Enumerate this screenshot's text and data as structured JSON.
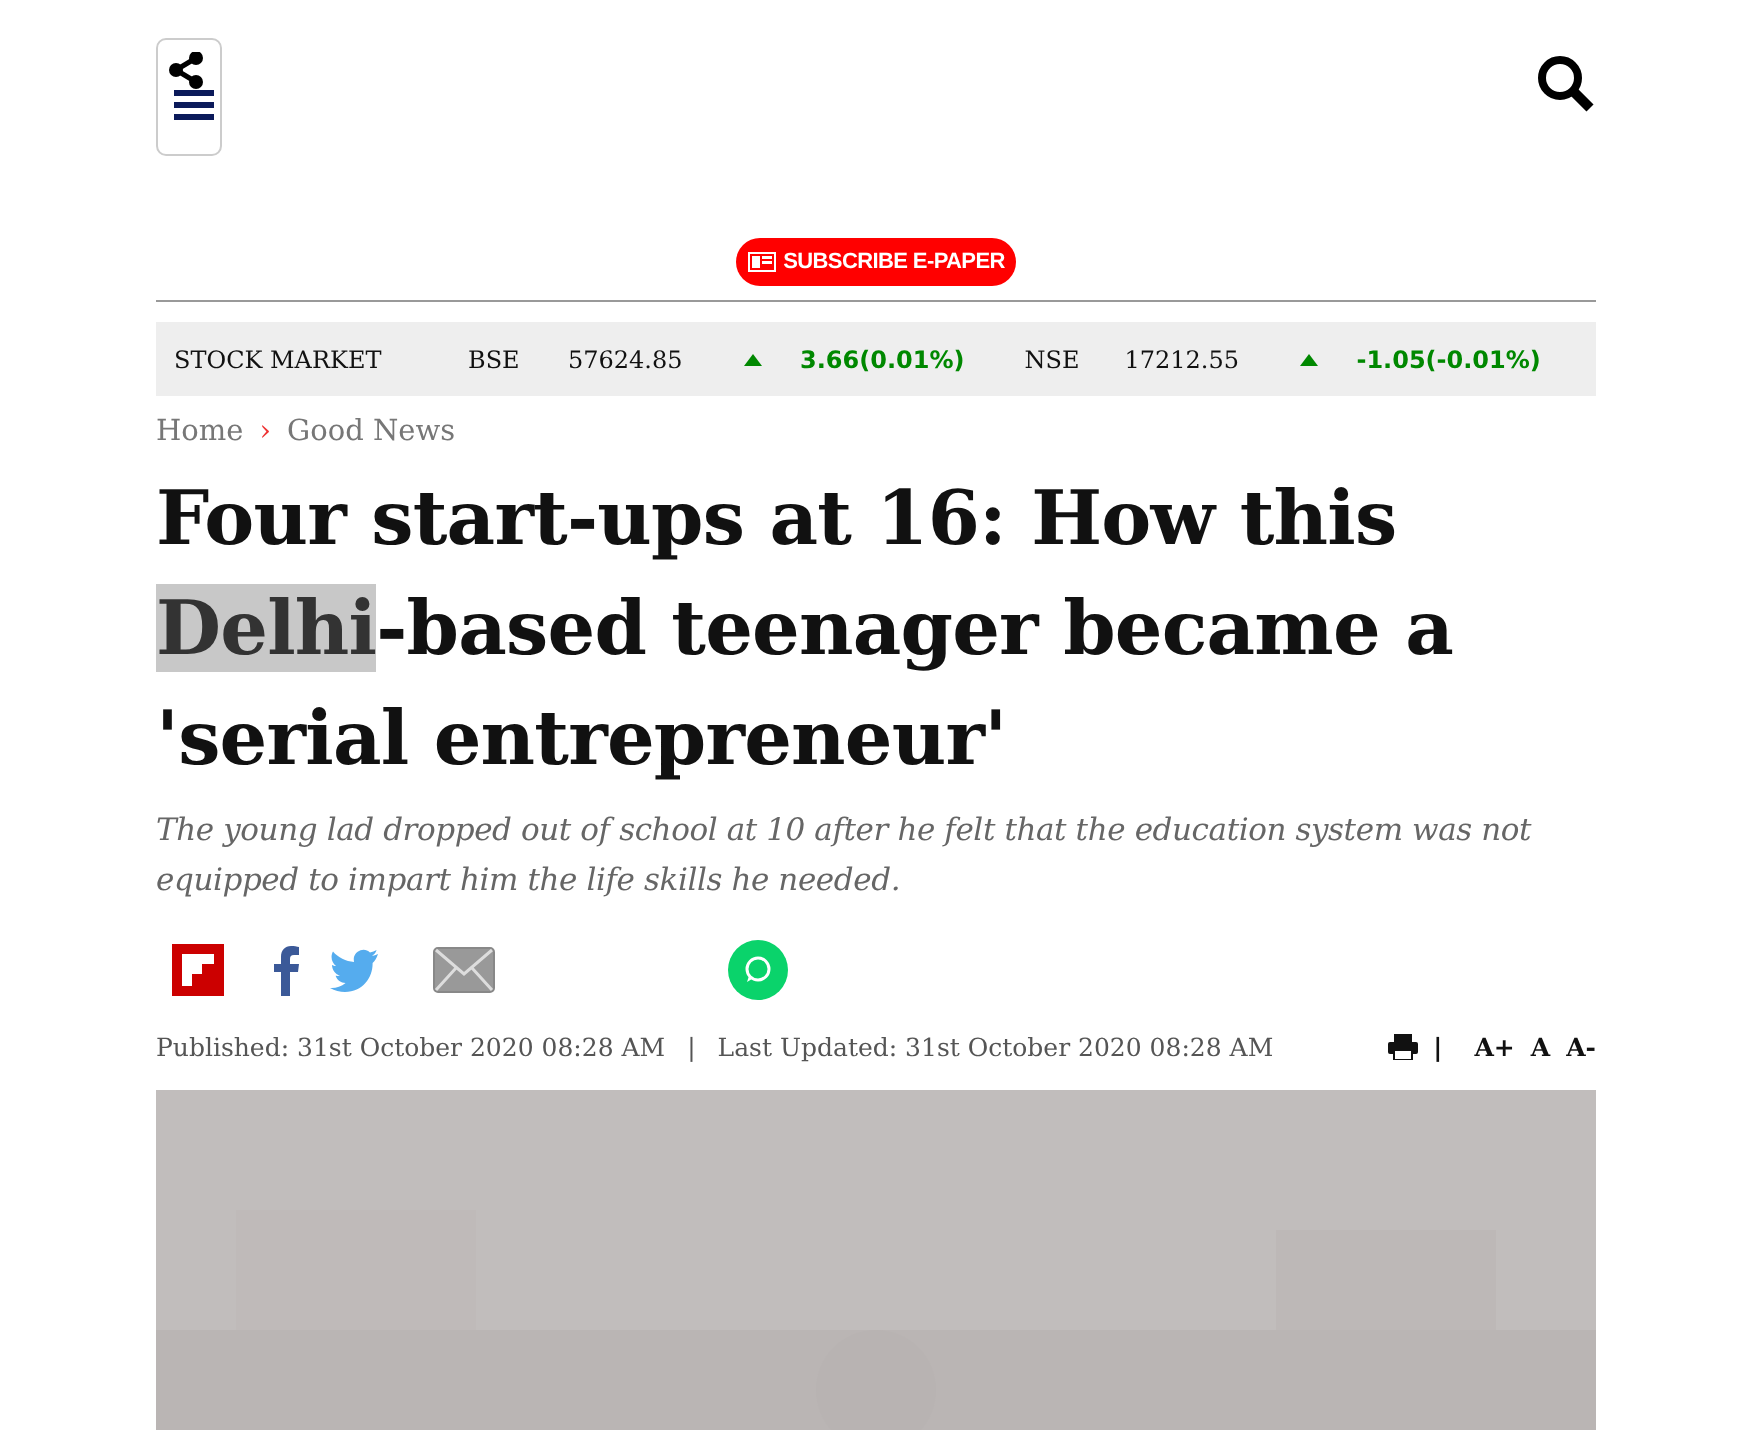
{
  "header": {
    "subscribe": "SUBSCRIBE E-PAPER"
  },
  "stock_market": {
    "label": "STOCK MARKET",
    "indices": [
      {
        "name": "BSE",
        "value": "57624.85",
        "change": "3.66(0.01%)",
        "up": true
      },
      {
        "name": "NSE",
        "value": "17212.55",
        "change": "-1.05(-0.01%)",
        "up": true
      }
    ]
  },
  "breadcrumb": {
    "items": [
      "Home",
      "Good News"
    ],
    "separator": "›"
  },
  "headline": [
    {
      "text": "Four start-ups at 16: How this ",
      "highlighted": false
    },
    {
      "text": "Delhi",
      "highlighted": true
    },
    {
      "text": "-based teenager became a 'serial entrepreneur'",
      "highlighted": false
    }
  ],
  "summary": "The young lad dropped out of school at 10 after he felt that the education system was not equipped to impart him the life skills he needed.",
  "meta": {
    "published": "Published: 31st October 2020 08:28 AM",
    "divider": "|",
    "updated": "Last Updated: 31st October 2020 08:28 AM",
    "tool_divider": "|",
    "font_sizes": [
      "A+",
      "A",
      "A-"
    ]
  }
}
